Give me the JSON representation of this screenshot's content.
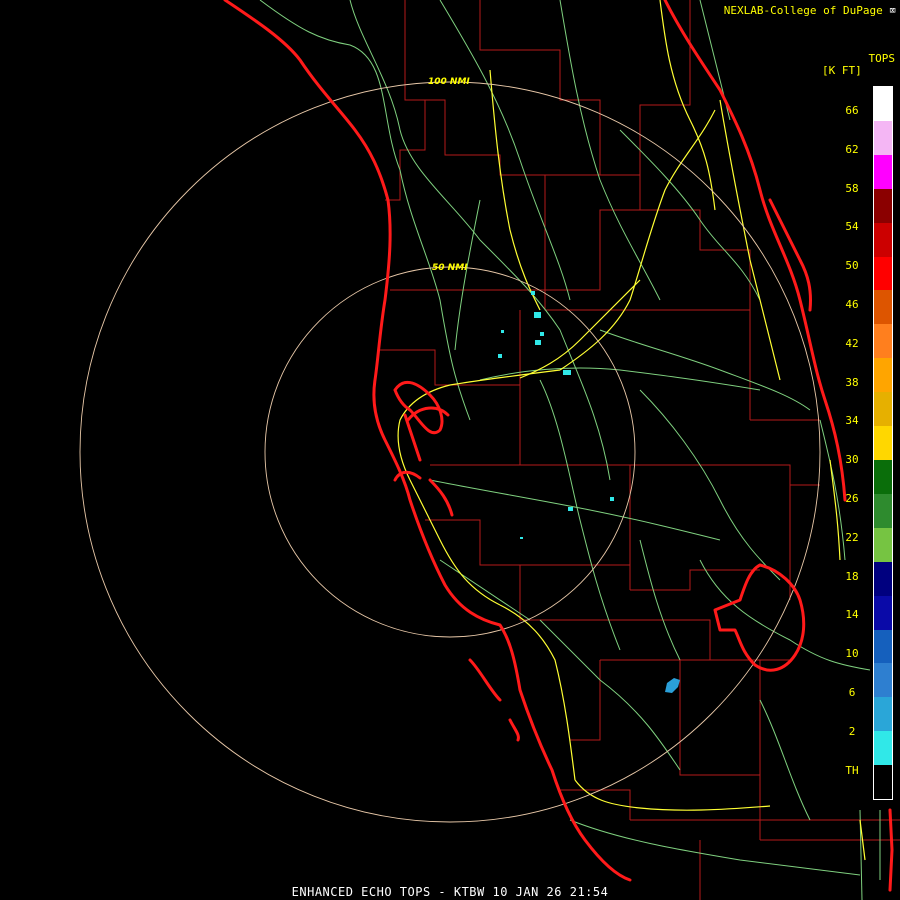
{
  "credit": {
    "text": "NEXLAB-College of DuPage",
    "logo_icon": "cod-logo-icon"
  },
  "legend": {
    "title_line1": "TOPS",
    "title_line2": "[K FT]",
    "labels": [
      "66",
      "62",
      "58",
      "54",
      "50",
      "46",
      "42",
      "38",
      "34",
      "30",
      "26",
      "22",
      "18",
      "14",
      "10",
      "6",
      "2",
      "TH"
    ],
    "colors": [
      "#ffffff",
      "#f4b6f4",
      "#ff00ff",
      "#8b0000",
      "#cc0000",
      "#ff0000",
      "#dd5500",
      "#ff7f1e",
      "#ffa500",
      "#e6b000",
      "#ffd700",
      "#0a6e0a",
      "#2e8b2e",
      "#76c442",
      "#00007f",
      "#0a0aa8",
      "#1560bd",
      "#2e7fd0",
      "#2aa6d8",
      "#30e8e8",
      "#000000"
    ]
  },
  "range_rings": [
    {
      "label": "50 NMI"
    },
    {
      "label": "100 NMI"
    }
  ],
  "product": {
    "label": "ENHANCED ECHO TOPS - KTBW 10 JAN 26 21:54"
  },
  "map_colors": {
    "coast": "#ff1a1a",
    "county": "#b31a1a",
    "river": "#7fd07f",
    "highway": "#ffff33",
    "ring": "#e8c8a8",
    "echo_light": "#30e8e8",
    "echo_mid": "#2a9fd8"
  }
}
